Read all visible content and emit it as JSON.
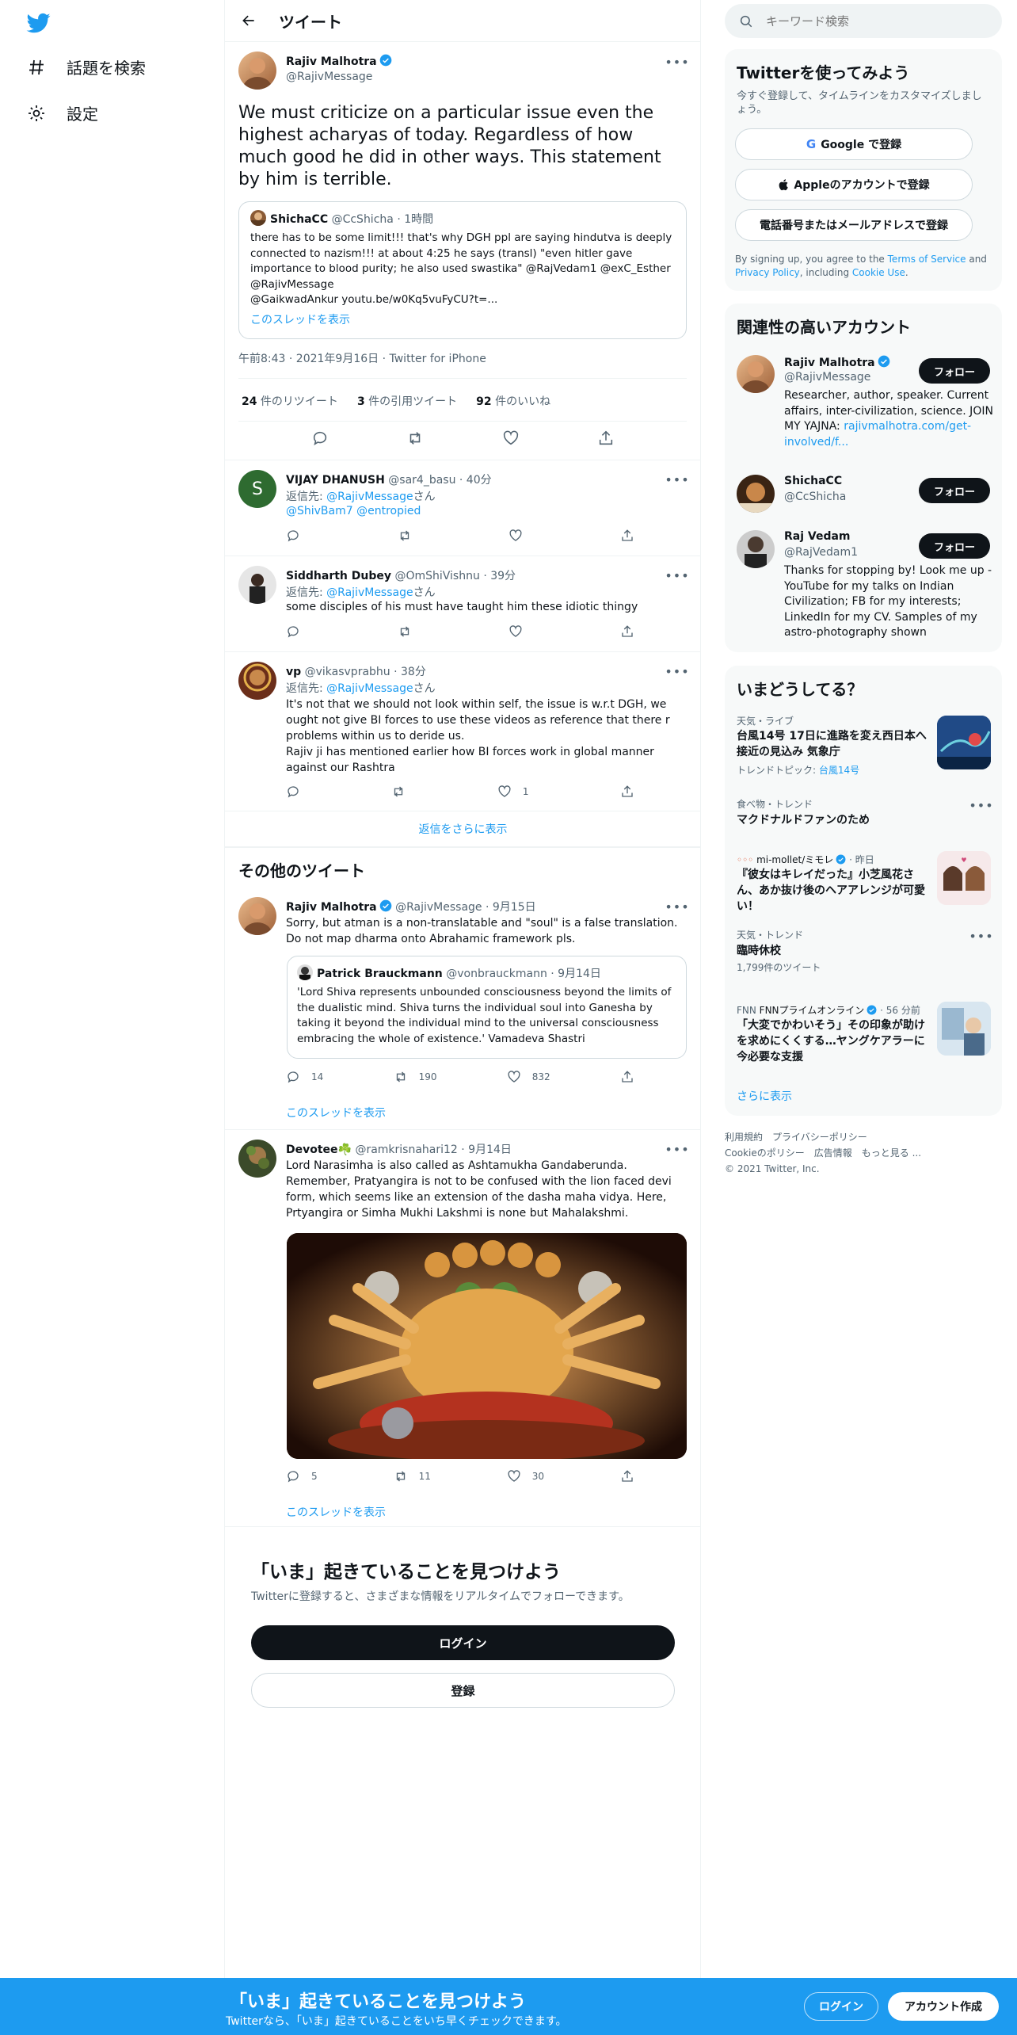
{
  "sidebar": {
    "explore": "話題を検索",
    "settings": "設定"
  },
  "header": {
    "title": "ツイート"
  },
  "main_tweet": {
    "name": "Rajiv Malhotra",
    "handle": "@RajivMessage",
    "text": "We must criticize on a particular issue even the highest acharyas of today. Regardless of how much good he did in other ways. This statement by him is terrible.",
    "quote": {
      "name": "ShichaCC",
      "handle": "@CcShicha",
      "time": "· 1時間",
      "text": "there has to be some limit!!! that's why DGH ppl are saying hindutva is deeply connected to nazism!!! at about 4:25 he says (transl) \"even hitler gave importance to blood purity; he also used swastika\" @RajVedam1 @exC_Esther @RajivMessage\n@GaikwadAnkur  youtu.be/w0Kq5vuFyCU?t=...",
      "thread_link": "このスレッドを表示"
    },
    "timestamp": "午前8:43 · 2021年9月16日 · Twitter for iPhone",
    "stats": {
      "retweets_n": "24",
      "retweets_label": " 件のリツイート",
      "quotes_n": "3",
      "quotes_label": " 件の引用ツイート",
      "likes_n": "92",
      "likes_label": " 件のいいね"
    }
  },
  "replies": [
    {
      "name": "VIJAY DHANUSH",
      "handle": "@sar4_basu",
      "time": "· 40分",
      "reply_prefix": "返信先: ",
      "reply_to": "@RajivMessage",
      "reply_suffix": "さん",
      "text": "@ShivBam7 @entropied",
      "avatar_letter": "S",
      "avatar_color": "#2e6b30"
    },
    {
      "name": "Siddharth Dubey",
      "handle": "@OmShiVishnu",
      "time": "· 39分",
      "reply_prefix": "返信先: ",
      "reply_to": "@RajivMessage",
      "reply_suffix": "さん",
      "text": "some disciples of his must have taught him these idiotic thingy"
    },
    {
      "name": "vp",
      "handle": "@vikasvprabhu",
      "time": "· 38分",
      "reply_prefix": "返信先: ",
      "reply_to": "@RajivMessage",
      "reply_suffix": "さん",
      "text": "It's not that we should not look within self, the issue is w.r.t DGH, we ought not give BI forces to use these videos as reference that there r problems within us to deride us.\nRajiv ji has mentioned earlier how BI forces work in global manner against our Rashtra",
      "likes": "1"
    }
  ],
  "show_more_replies": "返信をさらに表示",
  "more_tweets": {
    "heading": "その他のツイート",
    "tweet1": {
      "name": "Rajiv Malhotra",
      "handle": "@RajivMessage",
      "time": "· 9月15日",
      "text": "Sorry, but atman is a non-translatable and \"soul\" is a false translation. Do not map dharma onto Abrahamic framework pls.",
      "quote": {
        "name": "Patrick Brauckmann",
        "handle": "@vonbrauckmann",
        "time": "· 9月14日",
        "text": "'Lord Shiva represents unbounded consciousness beyond the limits of the dualistic mind. Shiva turns the individual soul into Ganesha by taking it beyond the individual mind to the universal consciousness embracing the whole of existence.' Vamadeva Shastri"
      },
      "replies": "14",
      "retweets": "190",
      "likes": "832",
      "thread_link": "このスレッドを表示"
    },
    "tweet2": {
      "name": "Devotee☘️",
      "handle": "@ramkrisnahari12",
      "time": "· 9月14日",
      "text": "Lord Narasimha is also called as Ashtamukha Gandaberunda. Remember, Pratyangira is not to be confused with the lion faced devi form, which seems like an extension of the dasha maha vidya. Here, Prtyangira or Simha Mukhi Lakshmi is none but Mahalakshmi.",
      "replies": "5",
      "retweets": "11",
      "likes": "30",
      "thread_link": "このスレッドを表示"
    }
  },
  "signup_prompt": {
    "title": "「いま」起きていることを見つけよう",
    "subtitle": "Twitterに登録すると、さまざまな情報をリアルタイムでフォローできます。",
    "login": "ログイン",
    "register": "登録"
  },
  "right": {
    "search_placeholder": "キーワード検索",
    "signup_card": {
      "title": "Twitterを使ってみよう",
      "subtitle": "今すぐ登録して、タイムラインをカスタマイズしましょう。",
      "google": "Google で登録",
      "apple": "Appleのアカウントで登録",
      "phone": "電話番号またはメールアドレスで登録",
      "terms_a": "By signing up, you agree to the ",
      "terms_link1": "Terms of Service",
      "terms_b": " and ",
      "terms_link2": "Privacy Policy",
      "terms_c": ", including ",
      "terms_link3": "Cookie Use",
      "terms_d": "."
    },
    "related": {
      "title": "関連性の高いアカウント",
      "follow": "フォロー",
      "accounts": [
        {
          "name": "Rajiv Malhotra",
          "handle": "@RajivMessage",
          "bio": "Researcher, author, speaker. Current affairs, inter-civilization, science. JOIN MY YAJNA: ",
          "bio_link": "rajivmalhotra.com/get-involved/f..."
        },
        {
          "name": "ShichaCC",
          "handle": "@CcShicha"
        },
        {
          "name": "Raj Vedam",
          "handle": "@RajVedam1",
          "bio": "Thanks for stopping by! Look me up - YouTube for my talks on Indian Civilization; FB for my interests; LinkedIn for my CV. Samples of my astro-photography shown"
        }
      ]
    },
    "trends": {
      "title": "いまどうしてる？",
      "items": [
        {
          "meta": "天気・ライブ",
          "title": "台風14号 17日に進路を変え西日本へ接近の見込み 気象庁",
          "sub_prefix": "トレンドトピック: ",
          "sub_link": "台風14号"
        },
        {
          "meta": "食べ物・トレンド",
          "title": "マクドナルドファンのため"
        },
        {
          "meta_source": "mi-mollet/ミモレ",
          "meta_time": "· 昨日",
          "title": "『彼女はキレイだった』小芝風花さん、あか抜け後のヘアアレンジが可愛い！"
        },
        {
          "meta": "天気・トレンド",
          "title": "臨時休校",
          "sub": "1,799件のツイート"
        },
        {
          "meta_source": "FNNプライムオンライン",
          "meta_time": "· 56 分前",
          "title": "「大変でかわいそう」その印象が助けを求めにくくする…ヤングケアラーに今必要な支援"
        }
      ],
      "more": "さらに表示"
    },
    "footer": {
      "terms": "利用規約",
      "privacy": "プライバシーポリシー",
      "cookie": "Cookieのポリシー",
      "ads": "広告情報",
      "more": "もっと見る ...",
      "copyright": "© 2021 Twitter, Inc."
    }
  },
  "bottom_bar": {
    "title": "「いま」起きていることを見つけよう",
    "subtitle": "Twitterなら、「いま」起きていることをいち早くチェックできます。",
    "login": "ログイン",
    "signup": "アカウント作成"
  },
  "colors": {
    "brand": "#1d9bf0",
    "text": "#0f1419",
    "muted": "#536471"
  }
}
